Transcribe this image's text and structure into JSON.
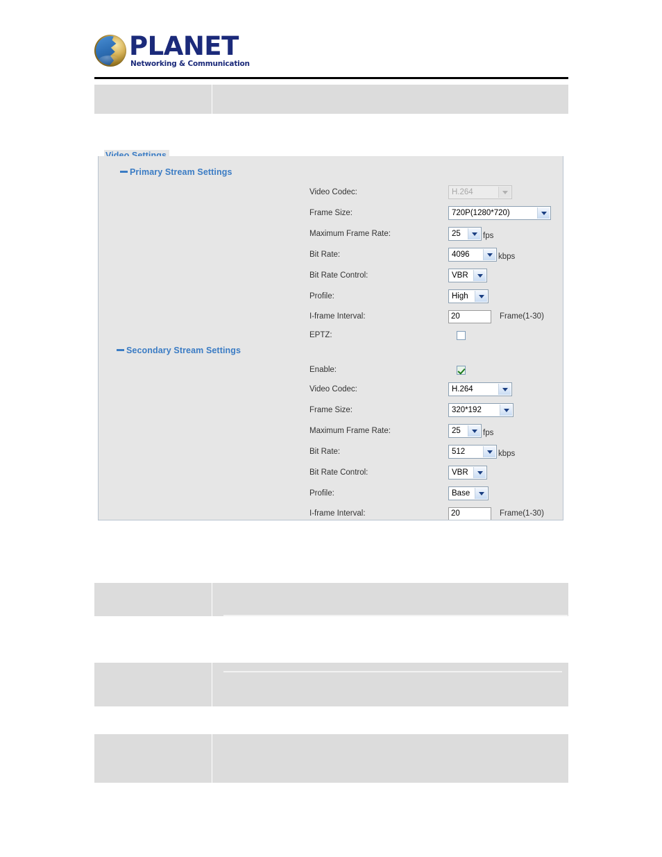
{
  "brand": {
    "logo_icon": "planet-globe-logo-icon",
    "name": "PLANET",
    "tagline": "Networking & Communication"
  },
  "panel": {
    "legend": "Video Settings",
    "groups": [
      {
        "id": "primary",
        "label": "Primary Stream Settings",
        "bullet_icon": "dash-bullet-icon"
      },
      {
        "id": "secondary",
        "label": "Secondary Stream Settings",
        "bullet_icon": "dash-bullet-icon"
      }
    ]
  },
  "primary_stream": {
    "video_codec": {
      "label": "Video Codec:",
      "value": "H.264",
      "disabled": true,
      "options": [
        "H.264"
      ]
    },
    "frame_size": {
      "label": "Frame Size:",
      "value": "720P(1280*720)",
      "options": [
        "720P(1280*720)"
      ]
    },
    "maximum_frame_rate": {
      "label": "Maximum Frame Rate:",
      "value": "25",
      "unit": "fps",
      "options": [
        "25"
      ]
    },
    "bit_rate": {
      "label": "Bit Rate:",
      "value": "4096",
      "unit": "kbps",
      "options": [
        "4096"
      ]
    },
    "bit_rate_control": {
      "label": "Bit Rate Control:",
      "value": "VBR",
      "options": [
        "VBR"
      ]
    },
    "profile": {
      "label": "Profile:",
      "value": "High",
      "options": [
        "High"
      ]
    },
    "iframe_interval": {
      "label": "I-frame Interval:",
      "value": "20",
      "hint": "Frame(1-30)"
    },
    "eptz": {
      "label": "EPTZ:",
      "checked": false
    }
  },
  "secondary_stream": {
    "enable": {
      "label": "Enable:",
      "checked": true
    },
    "video_codec": {
      "label": "Video Codec:",
      "value": "H.264",
      "options": [
        "H.264"
      ]
    },
    "frame_size": {
      "label": "Frame Size:",
      "value": "320*192",
      "options": [
        "320*192"
      ]
    },
    "maximum_frame_rate": {
      "label": "Maximum Frame Rate:",
      "value": "25",
      "unit": "fps",
      "options": [
        "25"
      ]
    },
    "bit_rate": {
      "label": "Bit Rate:",
      "value": "512",
      "unit": "kbps",
      "options": [
        "512"
      ]
    },
    "bit_rate_control": {
      "label": "Bit Rate Control:",
      "value": "VBR",
      "options": [
        "VBR"
      ]
    },
    "profile": {
      "label": "Profile:",
      "value": "Base",
      "options": [
        "Base"
      ]
    },
    "iframe_interval": {
      "label": "I-frame Interval:",
      "value": "20",
      "hint": "Frame(1-30)"
    }
  },
  "colors": {
    "accent_blue": "#3b7cc4",
    "brand_navy": "#1b2a7a",
    "panel_bg": "#e6e6e6",
    "table_bg": "#dcdcdc",
    "rule": "#000000"
  },
  "tables": [
    {
      "id": "header-table",
      "left_cell": "",
      "right_cell": ""
    },
    {
      "id": "table-2",
      "left_cell": "",
      "right_cell": ""
    },
    {
      "id": "table-3",
      "left_cell": "",
      "right_cell": ""
    },
    {
      "id": "table-4",
      "left_cell": "",
      "right_cell": ""
    }
  ]
}
